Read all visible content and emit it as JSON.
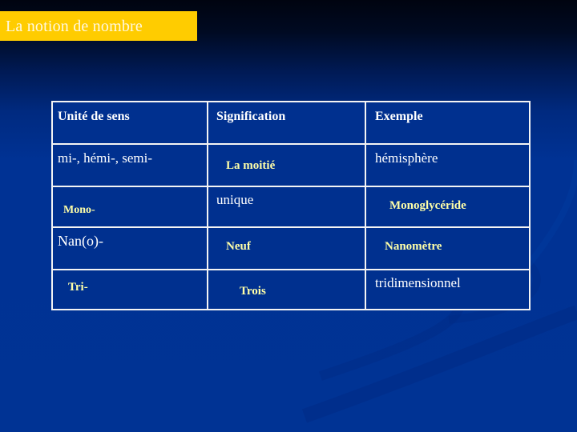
{
  "slide": {
    "title": "La notion de nombre",
    "colors": {
      "title_background": "#ffcc00",
      "title_text": "#fff8e0",
      "background": "#003394",
      "background_top": "#000410",
      "table_border": "#f4f4f4",
      "text_white": "#ffffff",
      "text_highlight": "#ffffa8"
    }
  },
  "table": {
    "headers": [
      "Unité de sens",
      "Signification",
      "Exemple"
    ],
    "rows": [
      [
        "mi-, hémi-, semi-",
        "La moitié",
        "hémisphère"
      ],
      [
        "Mono-",
        "unique",
        "Monoglycéride"
      ],
      [
        "Nan(o)-",
        "Neuf",
        "Nanomètre"
      ],
      [
        "Tri-",
        "Trois",
        "tridimensionnel"
      ]
    ]
  }
}
